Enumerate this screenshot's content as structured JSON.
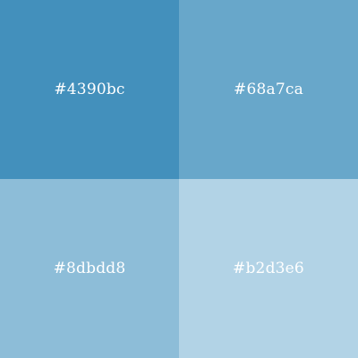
{
  "swatches": [
    {
      "label": "#4390bc",
      "color": "#4390bc"
    },
    {
      "label": "#68a7ca",
      "color": "#68a7ca"
    },
    {
      "label": "#8dbdd8",
      "color": "#8dbdd8"
    },
    {
      "label": "#b2d3e6",
      "color": "#b2d3e6"
    }
  ]
}
